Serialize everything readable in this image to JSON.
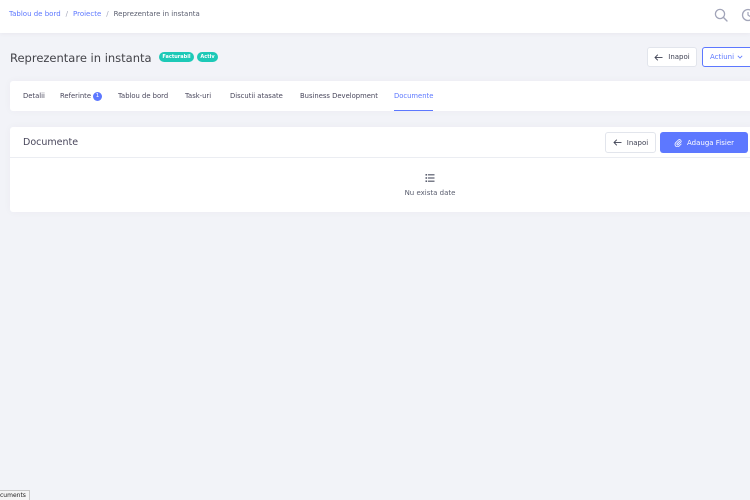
{
  "breadcrumb": {
    "home": "Tablou de bord",
    "projects": "Proiecte",
    "current": "Reprezentare in instanta"
  },
  "topbar": {
    "icons": [
      "search-icon",
      "history-icon"
    ]
  },
  "page": {
    "title": "Reprezentare in instanta",
    "badges": [
      "Facturabil",
      "Activ"
    ],
    "back_label": "Inapoi",
    "actions_label": "Actiuni"
  },
  "tabs": [
    {
      "label": "Detalii"
    },
    {
      "label": "Referinte",
      "count": "1"
    },
    {
      "label": "Tablou de bord"
    },
    {
      "label": "Task-uri"
    },
    {
      "label": "Discutii atasate"
    },
    {
      "label": "Business Development"
    },
    {
      "label": "Documente",
      "active": true
    }
  ],
  "documents": {
    "title": "Documente",
    "back_label": "Inapoi",
    "add_label": "Adauga Fisier",
    "empty_text": "Nu exista date"
  },
  "status_bar": {
    "text": "cuments"
  },
  "colors": {
    "accent": "#5d78ff",
    "badge": "#1dc9b7",
    "background": "#f2f3f8"
  }
}
